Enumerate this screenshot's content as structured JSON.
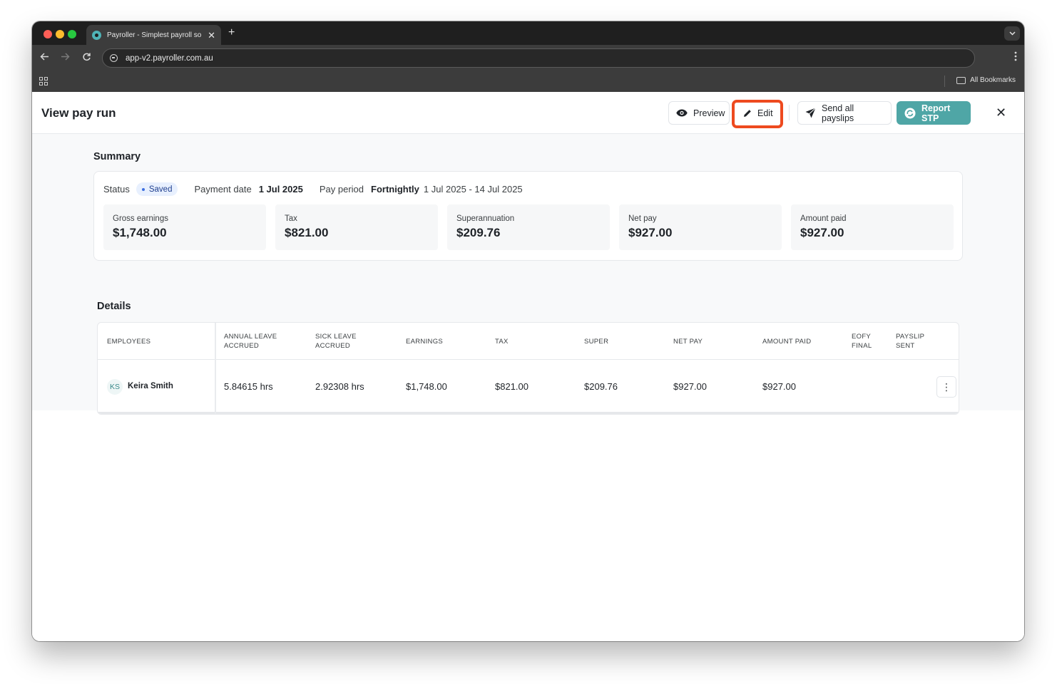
{
  "browser": {
    "tab_title": "Payroller - Simplest payroll so",
    "tab_close": "✕",
    "new_tab": "+",
    "url": "app-v2.payroller.com.au",
    "all_bookmarks": "All Bookmarks"
  },
  "header": {
    "title": "View pay run",
    "preview_label": "Preview",
    "edit_label": "Edit",
    "send_label": "Send all payslips",
    "report_label": "Report STP",
    "close_glyph": "✕"
  },
  "summary": {
    "title": "Summary",
    "status_label": "Status",
    "status_value": "Saved",
    "payment_date_label": "Payment date",
    "payment_date_value": "1 Jul 2025",
    "pay_period_label": "Pay period",
    "pay_period_frequency": "Fortnightly",
    "pay_period_range": "1 Jul 2025 - 14 Jul 2025",
    "stats": [
      {
        "label": "Gross earnings",
        "value": "$1,748.00"
      },
      {
        "label": "Tax",
        "value": "$821.00"
      },
      {
        "label": "Superannuation",
        "value": "$209.76"
      },
      {
        "label": "Net pay",
        "value": "$927.00"
      },
      {
        "label": "Amount paid",
        "value": "$927.00"
      }
    ]
  },
  "details": {
    "title": "Details",
    "columns": {
      "employees": "EMPLOYEES",
      "annual_leave_1": "ANNUAL LEAVE",
      "annual_leave_2": "ACCRUED",
      "sick_leave_1": "SICK LEAVE",
      "sick_leave_2": "ACCRUED",
      "earnings": "EARNINGS",
      "tax": "TAX",
      "super": "SUPER",
      "net_pay": "NET PAY",
      "amount_paid": "AMOUNT PAID",
      "eofy_1": "EOFY",
      "eofy_2": "FINAL",
      "payslip_1": "PAYSLIP",
      "payslip_2": "SENT"
    },
    "rows": [
      {
        "initials": "KS",
        "name": "Keira Smith",
        "annual_leave": "5.84615 hrs",
        "sick_leave": "2.92308 hrs",
        "earnings": "$1,748.00",
        "tax": "$821.00",
        "super": "$209.76",
        "net_pay": "$927.00",
        "amount_paid": "$927.00",
        "menu": "⋮"
      }
    ]
  },
  "colors": {
    "accent": "#4fa6a6",
    "highlight": "#ee4a1f",
    "badge_bg": "#e8f0fe"
  },
  "icons": [
    "eye-icon",
    "pencil-icon",
    "paper-plane-icon",
    "stp-sync-icon",
    "close-icon",
    "kebab-icon"
  ]
}
